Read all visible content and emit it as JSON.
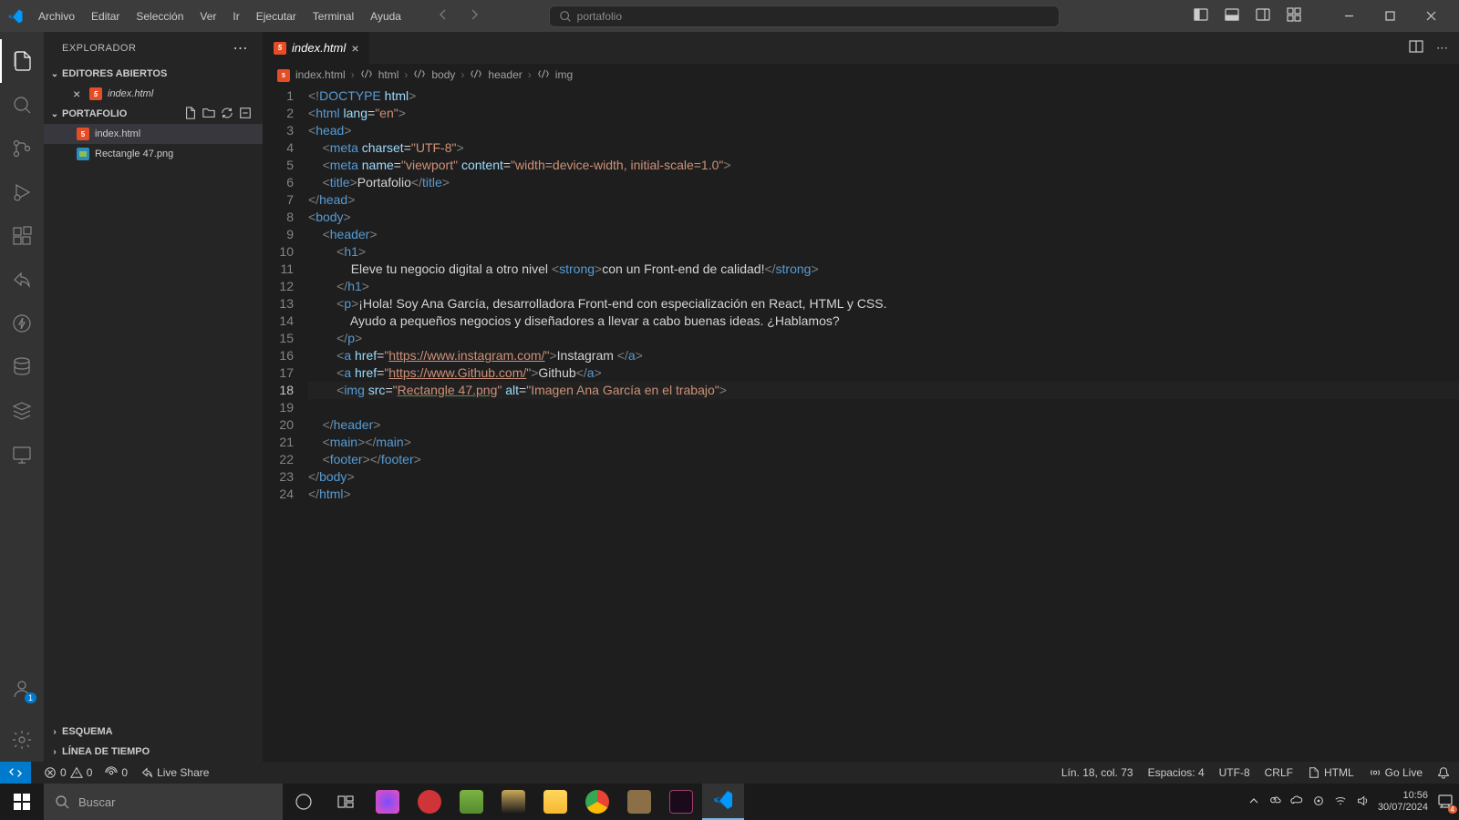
{
  "titlebar": {
    "menu": [
      "Archivo",
      "Editar",
      "Selección",
      "Ver",
      "Ir",
      "Ejecutar",
      "Terminal",
      "Ayuda"
    ],
    "search_placeholder": "portafolio"
  },
  "sidebar": {
    "title": "EXPLORADOR",
    "open_editors_label": "EDITORES ABIERTOS",
    "open_editors": [
      {
        "name": "index.html"
      }
    ],
    "folder_label": "PORTAFOLIO",
    "files": [
      {
        "name": "index.html",
        "type": "html",
        "selected": true
      },
      {
        "name": "Rectangle 47.png",
        "type": "img",
        "selected": false
      }
    ],
    "outline_label": "ESQUEMA",
    "timeline_label": "LÍNEA DE TIEMPO"
  },
  "tabs": {
    "active": "index.html"
  },
  "breadcrumbs": [
    "index.html",
    "html",
    "body",
    "header",
    "img"
  ],
  "code": {
    "active_line": 18,
    "lines": [
      {
        "n": 1,
        "html": "<span class='c-brk'>&lt;!</span><span class='c-tag'>DOCTYPE</span> <span class='c-attr'>html</span><span class='c-brk'>&gt;</span>"
      },
      {
        "n": 2,
        "html": "<span class='c-brk'>&lt;</span><span class='c-tag'>html</span> <span class='c-attr'>lang</span><span class='c-txt'>=</span><span class='c-str'>\"en\"</span><span class='c-brk'>&gt;</span>"
      },
      {
        "n": 3,
        "html": "<span class='c-brk'>&lt;</span><span class='c-tag'>head</span><span class='c-brk'>&gt;</span>"
      },
      {
        "n": 4,
        "html": "    <span class='c-brk'>&lt;</span><span class='c-tag'>meta</span> <span class='c-attr'>charset</span><span class='c-txt'>=</span><span class='c-str'>\"UTF-8\"</span><span class='c-brk'>&gt;</span>"
      },
      {
        "n": 5,
        "html": "    <span class='c-brk'>&lt;</span><span class='c-tag'>meta</span> <span class='c-attr'>name</span><span class='c-txt'>=</span><span class='c-str'>\"viewport\"</span> <span class='c-attr'>content</span><span class='c-txt'>=</span><span class='c-str'>\"width=device-width, initial-scale=1.0\"</span><span class='c-brk'>&gt;</span>"
      },
      {
        "n": 6,
        "html": "    <span class='c-brk'>&lt;</span><span class='c-tag'>title</span><span class='c-brk'>&gt;</span><span class='c-txt'>Portafolio</span><span class='c-brk'>&lt;/</span><span class='c-tag'>title</span><span class='c-brk'>&gt;</span>"
      },
      {
        "n": 7,
        "html": "<span class='c-brk'>&lt;/</span><span class='c-tag'>head</span><span class='c-brk'>&gt;</span>"
      },
      {
        "n": 8,
        "html": "<span class='c-brk'>&lt;</span><span class='c-tag'>body</span><span class='c-brk'>&gt;</span>"
      },
      {
        "n": 9,
        "html": "    <span class='c-brk'>&lt;</span><span class='c-tag'>header</span><span class='c-brk'>&gt;</span>"
      },
      {
        "n": 10,
        "html": "        <span class='c-brk'>&lt;</span><span class='c-tag'>h1</span><span class='c-brk'>&gt;</span>"
      },
      {
        "n": 11,
        "html": "            <span class='c-txt'>Eleve tu negocio digital a otro nivel </span><span class='c-brk'>&lt;</span><span class='c-tag'>strong</span><span class='c-brk'>&gt;</span><span class='c-txt'>con un Front-end de calidad!</span><span class='c-brk'>&lt;/</span><span class='c-tag'>strong</span><span class='c-brk'>&gt;</span>"
      },
      {
        "n": 12,
        "html": "        <span class='c-brk'>&lt;/</span><span class='c-tag'>h1</span><span class='c-brk'>&gt;</span>"
      },
      {
        "n": 13,
        "html": "        <span class='c-brk'>&lt;</span><span class='c-tag'>p</span><span class='c-brk'>&gt;</span><span class='c-txt'>¡Hola! Soy Ana García, desarrolladora Front-end con especialización en React, HTML y CSS.</span>"
      },
      {
        "n": 14,
        "html": "            <span class='c-txt'>Ayudo a pequeños negocios y diseñadores a llevar a cabo buenas ideas. ¿Hablamos?</span>"
      },
      {
        "n": 15,
        "html": "        <span class='c-brk'>&lt;/</span><span class='c-tag'>p</span><span class='c-brk'>&gt;</span>"
      },
      {
        "n": 16,
        "html": "        <span class='c-brk'>&lt;</span><span class='c-tag'>a</span> <span class='c-attr'>href</span><span class='c-txt'>=</span><span class='c-str'>\"</span><span class='c-link'>https://www.instagram.com/</span><span class='c-str'>\"</span><span class='c-brk'>&gt;</span><span class='c-txt'>Instagram </span><span class='c-brk'>&lt;/</span><span class='c-tag'>a</span><span class='c-brk'>&gt;</span>"
      },
      {
        "n": 17,
        "html": "        <span class='c-brk'>&lt;</span><span class='c-tag'>a</span> <span class='c-attr'>href</span><span class='c-txt'>=</span><span class='c-str'>\"</span><span class='c-link'>https://www.Github.com/</span><span class='c-str'>\"</span><span class='c-brk'>&gt;</span><span class='c-txt'>Github</span><span class='c-brk'>&lt;/</span><span class='c-tag'>a</span><span class='c-brk'>&gt;</span>"
      },
      {
        "n": 18,
        "html": "        <span class='c-brk'>&lt;</span><span class='c-tag'>img</span> <span class='c-attr'>src</span><span class='c-txt'>=</span><span class='c-str'>\"</span><span class='c-link2'>Rectangle 47.png</span><span class='c-str'>\"</span> <span class='c-attr'>alt</span><span class='c-txt'>=</span><span class='c-str'>\"Imagen Ana García en el trabajo\"</span><span class='c-brk'>&gt;</span>"
      },
      {
        "n": 19,
        "html": ""
      },
      {
        "n": 20,
        "html": "    <span class='c-brk'>&lt;/</span><span class='c-tag'>header</span><span class='c-brk'>&gt;</span>"
      },
      {
        "n": 21,
        "html": "    <span class='c-brk'>&lt;</span><span class='c-tag'>main</span><span class='c-brk'>&gt;&lt;/</span><span class='c-tag'>main</span><span class='c-brk'>&gt;</span>"
      },
      {
        "n": 22,
        "html": "    <span class='c-brk'>&lt;</span><span class='c-tag'>footer</span><span class='c-brk'>&gt;&lt;/</span><span class='c-tag'>footer</span><span class='c-brk'>&gt;</span>"
      },
      {
        "n": 23,
        "html": "<span class='c-brk'>&lt;/</span><span class='c-tag'>body</span><span class='c-brk'>&gt;</span>"
      },
      {
        "n": 24,
        "html": "<span class='c-brk'>&lt;/</span><span class='c-tag'>html</span><span class='c-brk'>&gt;</span>"
      }
    ]
  },
  "statusbar": {
    "errors": "0",
    "warnings": "0",
    "ports": "0",
    "live_share": "Live Share",
    "cursor": "Lín. 18, col. 73",
    "spaces": "Espacios: 4",
    "encoding": "UTF-8",
    "eol": "CRLF",
    "language": "HTML",
    "golive": "Go Live"
  },
  "taskbar": {
    "search_placeholder": "Buscar",
    "time": "10:56",
    "date": "30/07/2024",
    "notif_count": "4"
  }
}
